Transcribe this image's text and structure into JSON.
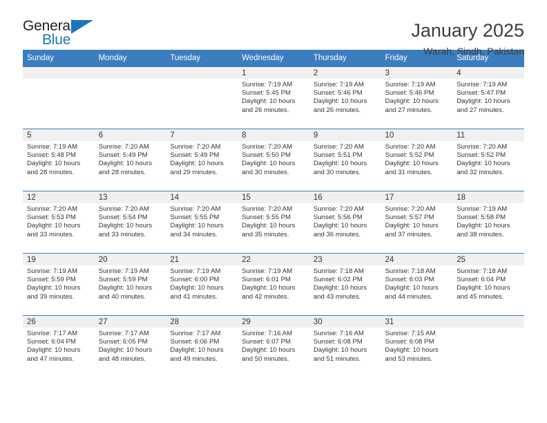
{
  "brand": {
    "name_part1": "General",
    "name_part2": "Blue"
  },
  "header": {
    "month_title": "January 2025",
    "location": "Warah, Sindh, Pakistan"
  },
  "weekdays": [
    "Sunday",
    "Monday",
    "Tuesday",
    "Wednesday",
    "Thursday",
    "Friday",
    "Saturday"
  ],
  "colors": {
    "header_blue": "#3b7dbf",
    "brand_blue": "#1b75bb",
    "daynum_bg": "#f0f0f0"
  },
  "weeks": [
    [
      {
        "day": "",
        "sunrise": "",
        "sunset": "",
        "daylight": ""
      },
      {
        "day": "",
        "sunrise": "",
        "sunset": "",
        "daylight": ""
      },
      {
        "day": "",
        "sunrise": "",
        "sunset": "",
        "daylight": ""
      },
      {
        "day": "1",
        "sunrise": "Sunrise: 7:19 AM",
        "sunset": "Sunset: 5:45 PM",
        "daylight": "Daylight: 10 hours and 26 minutes."
      },
      {
        "day": "2",
        "sunrise": "Sunrise: 7:19 AM",
        "sunset": "Sunset: 5:46 PM",
        "daylight": "Daylight: 10 hours and 26 minutes."
      },
      {
        "day": "3",
        "sunrise": "Sunrise: 7:19 AM",
        "sunset": "Sunset: 5:46 PM",
        "daylight": "Daylight: 10 hours and 27 minutes."
      },
      {
        "day": "4",
        "sunrise": "Sunrise: 7:19 AM",
        "sunset": "Sunset: 5:47 PM",
        "daylight": "Daylight: 10 hours and 27 minutes."
      }
    ],
    [
      {
        "day": "5",
        "sunrise": "Sunrise: 7:19 AM",
        "sunset": "Sunset: 5:48 PM",
        "daylight": "Daylight: 10 hours and 28 minutes."
      },
      {
        "day": "6",
        "sunrise": "Sunrise: 7:20 AM",
        "sunset": "Sunset: 5:49 PM",
        "daylight": "Daylight: 10 hours and 28 minutes."
      },
      {
        "day": "7",
        "sunrise": "Sunrise: 7:20 AM",
        "sunset": "Sunset: 5:49 PM",
        "daylight": "Daylight: 10 hours and 29 minutes."
      },
      {
        "day": "8",
        "sunrise": "Sunrise: 7:20 AM",
        "sunset": "Sunset: 5:50 PM",
        "daylight": "Daylight: 10 hours and 30 minutes."
      },
      {
        "day": "9",
        "sunrise": "Sunrise: 7:20 AM",
        "sunset": "Sunset: 5:51 PM",
        "daylight": "Daylight: 10 hours and 30 minutes."
      },
      {
        "day": "10",
        "sunrise": "Sunrise: 7:20 AM",
        "sunset": "Sunset: 5:52 PM",
        "daylight": "Daylight: 10 hours and 31 minutes."
      },
      {
        "day": "11",
        "sunrise": "Sunrise: 7:20 AM",
        "sunset": "Sunset: 5:52 PM",
        "daylight": "Daylight: 10 hours and 32 minutes."
      }
    ],
    [
      {
        "day": "12",
        "sunrise": "Sunrise: 7:20 AM",
        "sunset": "Sunset: 5:53 PM",
        "daylight": "Daylight: 10 hours and 33 minutes."
      },
      {
        "day": "13",
        "sunrise": "Sunrise: 7:20 AM",
        "sunset": "Sunset: 5:54 PM",
        "daylight": "Daylight: 10 hours and 33 minutes."
      },
      {
        "day": "14",
        "sunrise": "Sunrise: 7:20 AM",
        "sunset": "Sunset: 5:55 PM",
        "daylight": "Daylight: 10 hours and 34 minutes."
      },
      {
        "day": "15",
        "sunrise": "Sunrise: 7:20 AM",
        "sunset": "Sunset: 5:55 PM",
        "daylight": "Daylight: 10 hours and 35 minutes."
      },
      {
        "day": "16",
        "sunrise": "Sunrise: 7:20 AM",
        "sunset": "Sunset: 5:56 PM",
        "daylight": "Daylight: 10 hours and 36 minutes."
      },
      {
        "day": "17",
        "sunrise": "Sunrise: 7:20 AM",
        "sunset": "Sunset: 5:57 PM",
        "daylight": "Daylight: 10 hours and 37 minutes."
      },
      {
        "day": "18",
        "sunrise": "Sunrise: 7:19 AM",
        "sunset": "Sunset: 5:58 PM",
        "daylight": "Daylight: 10 hours and 38 minutes."
      }
    ],
    [
      {
        "day": "19",
        "sunrise": "Sunrise: 7:19 AM",
        "sunset": "Sunset: 5:59 PM",
        "daylight": "Daylight: 10 hours and 39 minutes."
      },
      {
        "day": "20",
        "sunrise": "Sunrise: 7:19 AM",
        "sunset": "Sunset: 5:59 PM",
        "daylight": "Daylight: 10 hours and 40 minutes."
      },
      {
        "day": "21",
        "sunrise": "Sunrise: 7:19 AM",
        "sunset": "Sunset: 6:00 PM",
        "daylight": "Daylight: 10 hours and 41 minutes."
      },
      {
        "day": "22",
        "sunrise": "Sunrise: 7:19 AM",
        "sunset": "Sunset: 6:01 PM",
        "daylight": "Daylight: 10 hours and 42 minutes."
      },
      {
        "day": "23",
        "sunrise": "Sunrise: 7:18 AM",
        "sunset": "Sunset: 6:02 PM",
        "daylight": "Daylight: 10 hours and 43 minutes."
      },
      {
        "day": "24",
        "sunrise": "Sunrise: 7:18 AM",
        "sunset": "Sunset: 6:03 PM",
        "daylight": "Daylight: 10 hours and 44 minutes."
      },
      {
        "day": "25",
        "sunrise": "Sunrise: 7:18 AM",
        "sunset": "Sunset: 6:04 PM",
        "daylight": "Daylight: 10 hours and 45 minutes."
      }
    ],
    [
      {
        "day": "26",
        "sunrise": "Sunrise: 7:17 AM",
        "sunset": "Sunset: 6:04 PM",
        "daylight": "Daylight: 10 hours and 47 minutes."
      },
      {
        "day": "27",
        "sunrise": "Sunrise: 7:17 AM",
        "sunset": "Sunset: 6:05 PM",
        "daylight": "Daylight: 10 hours and 48 minutes."
      },
      {
        "day": "28",
        "sunrise": "Sunrise: 7:17 AM",
        "sunset": "Sunset: 6:06 PM",
        "daylight": "Daylight: 10 hours and 49 minutes."
      },
      {
        "day": "29",
        "sunrise": "Sunrise: 7:16 AM",
        "sunset": "Sunset: 6:07 PM",
        "daylight": "Daylight: 10 hours and 50 minutes."
      },
      {
        "day": "30",
        "sunrise": "Sunrise: 7:16 AM",
        "sunset": "Sunset: 6:08 PM",
        "daylight": "Daylight: 10 hours and 51 minutes."
      },
      {
        "day": "31",
        "sunrise": "Sunrise: 7:15 AM",
        "sunset": "Sunset: 6:08 PM",
        "daylight": "Daylight: 10 hours and 53 minutes."
      },
      {
        "day": "",
        "sunrise": "",
        "sunset": "",
        "daylight": ""
      }
    ]
  ]
}
